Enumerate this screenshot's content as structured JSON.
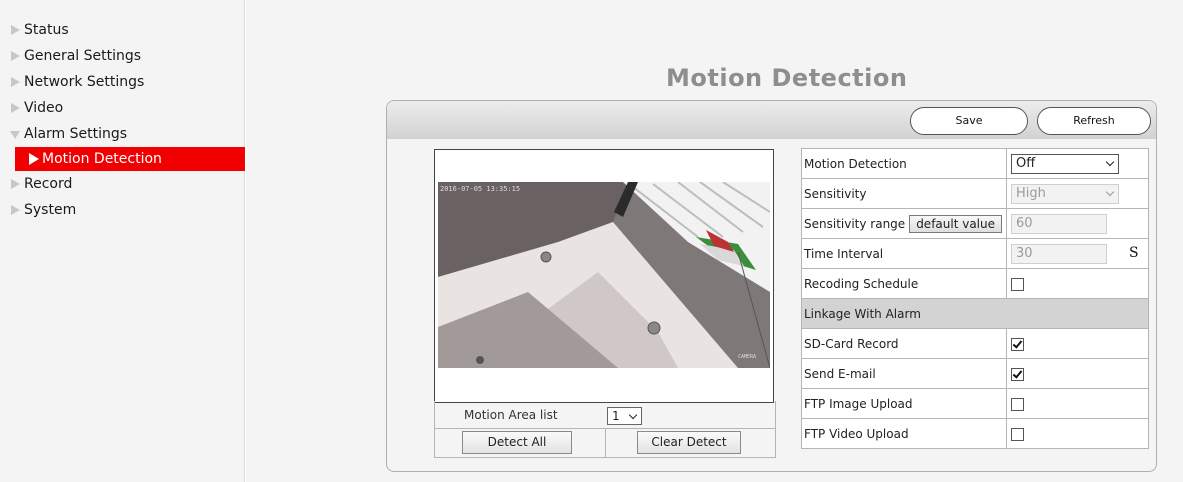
{
  "sidebar": {
    "items": [
      {
        "label": "Status"
      },
      {
        "label": "General Settings"
      },
      {
        "label": "Network Settings"
      },
      {
        "label": "Video"
      },
      {
        "label": "Alarm Settings"
      },
      {
        "label": "Motion Detection"
      },
      {
        "label": "Record"
      },
      {
        "label": "System"
      }
    ]
  },
  "page_title": "Motion Detection",
  "toolbar": {
    "save_label": "Save",
    "refresh_label": "Refresh"
  },
  "video": {
    "timestamp": "2016-07-05 13:35:15",
    "watermark": "CAMERA"
  },
  "motion_area": {
    "label": "Motion Area list",
    "value": "1"
  },
  "buttons": {
    "detect_all": "Detect All",
    "clear_detect": "Clear Detect"
  },
  "settings": {
    "motion_detection": {
      "label": "Motion Detection",
      "value": "Off"
    },
    "sensitivity": {
      "label": "Sensitivity",
      "value": "High"
    },
    "sensitivity_range": {
      "label": "Sensitivity range",
      "button": "default value",
      "value": "60"
    },
    "time_interval": {
      "label": "Time Interval",
      "value": "30",
      "unit": "S"
    },
    "recording_schedule": {
      "label": "Recoding Schedule",
      "checked": false
    },
    "linkage_header": "Linkage With Alarm",
    "sd_card_record": {
      "label": "SD-Card Record",
      "checked": true
    },
    "send_email": {
      "label": "Send E-mail",
      "checked": true
    },
    "ftp_image_upload": {
      "label": "FTP Image Upload",
      "checked": false
    },
    "ftp_video_upload": {
      "label": "FTP Video Upload",
      "checked": false
    }
  },
  "colors": {
    "active_nav": "#f00000",
    "title": "#8e8e8e",
    "section_header": "#d3d3d3"
  }
}
